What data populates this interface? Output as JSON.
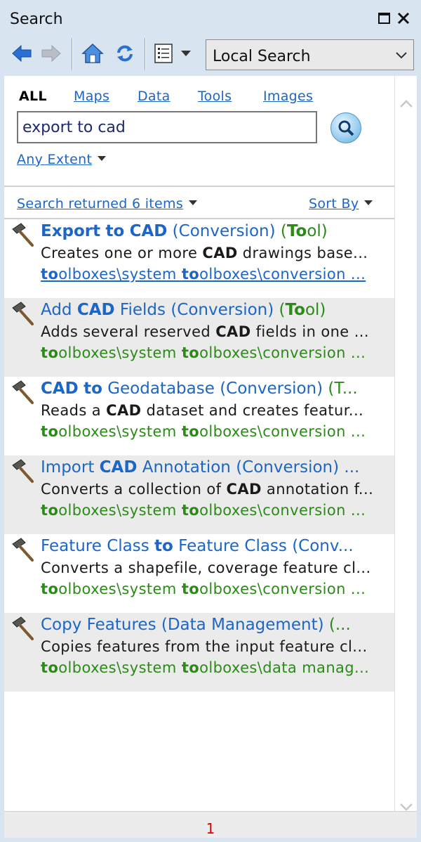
{
  "window": {
    "title": "Search"
  },
  "toolbar": {
    "scope_selected": "Local Search"
  },
  "tabs": [
    {
      "label": "ALL",
      "active": true
    },
    {
      "label": "Maps"
    },
    {
      "label": "Data"
    },
    {
      "label": "Tools"
    },
    {
      "label": "Images"
    }
  ],
  "search": {
    "query": "export to cad",
    "extent_label": "Any Extent"
  },
  "results_bar": {
    "summary": "Search returned 6 items",
    "sort_label": "Sort By"
  },
  "results": [
    {
      "title": "Export to CAD",
      "category": " (Conversion)",
      "type": " (Tool)",
      "description": "Creates one or more CAD drawings base...",
      "path": "toolboxes\\system toolboxes\\conversion ..."
    },
    {
      "title": "Add CAD Fields",
      "category": " (Conversion)",
      "type": " (Tool)",
      "description": "Adds several reserved CAD fields in one ...",
      "path": "toolboxes\\system toolboxes\\conversion ..."
    },
    {
      "title": "CAD to Geodatabase",
      "category": " (Conversion)",
      "type": " (T...",
      "description": "Reads a CAD dataset and creates featur...",
      "path": "toolboxes\\system toolboxes\\conversion ..."
    },
    {
      "title": "Import CAD Annotation",
      "category": " (Conversion) ...",
      "type": "",
      "description": "Converts a collection of CAD annotation f...",
      "path": "toolboxes\\system toolboxes\\conversion ..."
    },
    {
      "title": "Feature Class to Feature Class (Conv...",
      "category": "",
      "type": "",
      "description": "Converts a shapefile, coverage feature cl...",
      "path": "toolboxes\\system toolboxes\\conversion ..."
    },
    {
      "title": "Copy Features",
      "category": " (Data Management)",
      "type": " (...",
      "description": "Copies features from the input feature cl...",
      "path": "toolboxes\\system toolboxes\\data manag..."
    }
  ],
  "status": {
    "page": "1"
  },
  "colors": {
    "link": "#1d66c6",
    "path_green": "#2b8a18",
    "chrome": "#d9e4f1",
    "alt_row": "#ebebeb",
    "page_red": "#e00000"
  }
}
